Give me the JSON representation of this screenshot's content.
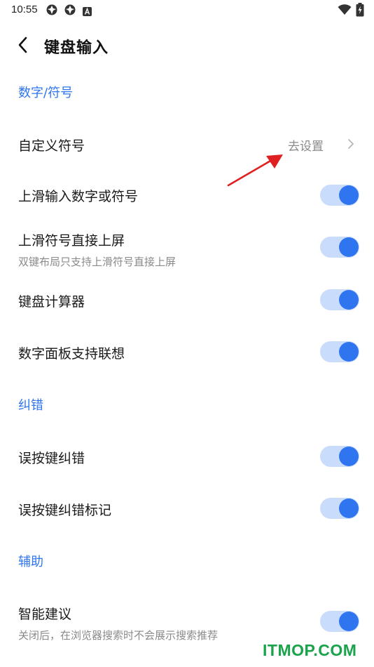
{
  "status_bar": {
    "time": "10:55",
    "icons": [
      "app-notification-icon",
      "app-notification-icon",
      "a-notification-icon",
      "wifi-icon",
      "battery-charging-icon"
    ]
  },
  "header": {
    "title": "键盘输入",
    "back_icon": "chevron-left-icon"
  },
  "sections": {
    "numbers_symbols": {
      "title": "数字/符号",
      "custom_symbols": {
        "label": "自定义符号",
        "value": "去设置"
      },
      "swipe_input": {
        "label": "上滑输入数字或符号",
        "enabled": true
      },
      "swipe_commit": {
        "label": "上滑符号直接上屏",
        "description": "双键布局只支持上滑符号直接上屏",
        "enabled": true
      },
      "calculator": {
        "label": "键盘计算器",
        "enabled": true
      },
      "numpad_prediction": {
        "label": "数字面板支持联想",
        "enabled": true
      }
    },
    "correction": {
      "title": "纠错",
      "mistype_correction": {
        "label": "误按键纠错",
        "enabled": true
      },
      "mistype_mark": {
        "label": "误按键纠错标记",
        "enabled": true
      }
    },
    "assist": {
      "title": "辅助",
      "smart_suggestion": {
        "label": "智能建议",
        "description": "关闭后，在浏览器搜索时不会展示搜索推荐",
        "enabled": true
      }
    }
  },
  "colors": {
    "accent": "#2f75f0",
    "toggle_track": "#c9dcfb",
    "annotation_arrow": "#e02020",
    "watermark": "#19a34a"
  },
  "watermark": "ITMOP.COM"
}
